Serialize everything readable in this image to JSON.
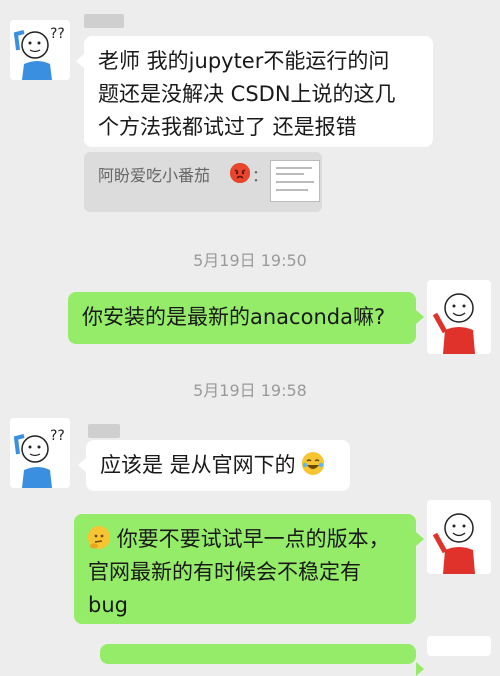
{
  "messages": [
    {
      "id": "m1",
      "direction": "incoming",
      "sender_blurred": true,
      "text_lines": [
        "老师 我的jupyter不能运行的问",
        "题还是没解决 CSDN上说的这几",
        "个方法我都试过了  还是报错"
      ]
    },
    {
      "id": "quote1",
      "quote_author": "阿盼爱吃小番茄",
      "quote_emoji": "angry-face-icon",
      "quote_suffix": "："
    },
    {
      "id": "t1",
      "timestamp": "5月19日 19:50"
    },
    {
      "id": "m2",
      "direction": "outgoing",
      "text": "你安装的是最新的anaconda嘛?"
    },
    {
      "id": "t2",
      "timestamp": "5月19日 19:58"
    },
    {
      "id": "m3",
      "direction": "incoming",
      "text": "应该是  是从官网下的",
      "trailing_emoji": "laughing-tears-icon"
    },
    {
      "id": "m4",
      "direction": "outgoing",
      "leading_emoji": "thinking-face-icon",
      "text_lines": [
        "你要不要试试早一点的版本，",
        "官网最新的有时候会不稳定有",
        "bug"
      ]
    }
  ],
  "colors": {
    "background": "#ededed",
    "incoming_bubble": "#ffffff",
    "outgoing_bubble": "#95ec69",
    "timestamp_text": "#9a9a9a"
  }
}
